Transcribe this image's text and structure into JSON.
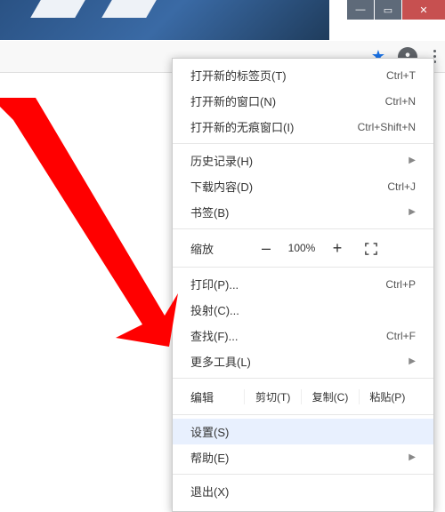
{
  "menu": {
    "new_tab": "打开新的标签页(T)",
    "new_tab_sc": "Ctrl+T",
    "new_window": "打开新的窗口(N)",
    "new_window_sc": "Ctrl+N",
    "incognito": "打开新的无痕窗口(I)",
    "incognito_sc": "Ctrl+Shift+N",
    "history": "历史记录(H)",
    "downloads": "下载内容(D)",
    "downloads_sc": "Ctrl+J",
    "bookmarks": "书签(B)",
    "zoom_label": "缩放",
    "zoom_value": "100%",
    "print": "打印(P)...",
    "print_sc": "Ctrl+P",
    "cast": "投射(C)...",
    "find": "查找(F)...",
    "find_sc": "Ctrl+F",
    "more_tools": "更多工具(L)",
    "edit_label": "编辑",
    "cut": "剪切(T)",
    "copy": "复制(C)",
    "paste": "粘贴(P)",
    "settings": "设置(S)",
    "help": "帮助(E)",
    "exit": "退出(X)"
  }
}
